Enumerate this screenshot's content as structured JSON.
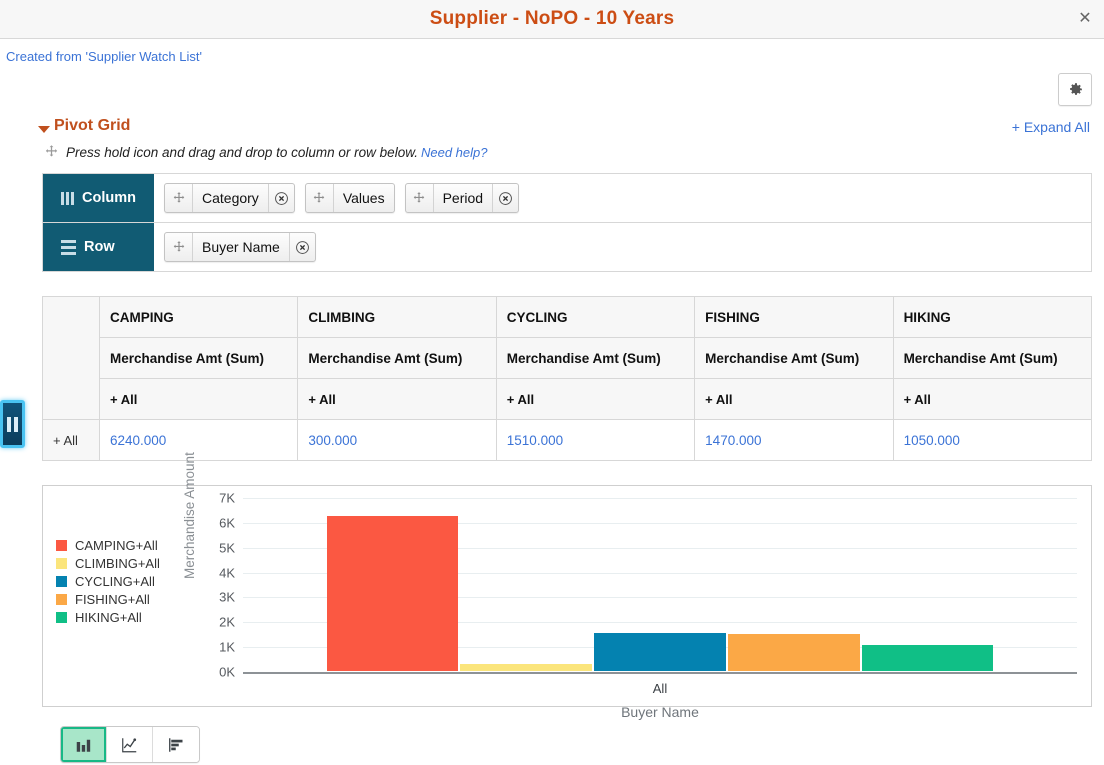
{
  "window": {
    "title": "Supplier - NoPO - 10 Years",
    "close_label": "✕",
    "close_icon": "close-icon",
    "title_color": "#cc4d14"
  },
  "subheader": {
    "created_from": "Created from 'Supplier Watch List'",
    "link_color": "#3b73d6"
  },
  "toolbar": {
    "gear_icon": "gear-icon"
  },
  "pivot": {
    "section_title": "Pivot Grid",
    "expand_all": "+ Expand All",
    "hint": "Press hold icon and drag and drop to column or row below.",
    "need_help": "Need help?",
    "move_icon": "move-icon",
    "zones": [
      {
        "label": "Column",
        "icon": "column-bars-icon",
        "chips": [
          {
            "label": "Category",
            "grip_icon": "move-icon",
            "close_icon": "remove-circle-icon",
            "removable": true
          },
          {
            "label": "Values",
            "grip_icon": "move-icon",
            "close_icon": "",
            "removable": false
          },
          {
            "label": "Period",
            "grip_icon": "move-icon",
            "close_icon": "remove-circle-icon",
            "removable": true
          }
        ]
      },
      {
        "label": "Row",
        "icon": "row-lines-icon",
        "chips": [
          {
            "label": "Buyer Name",
            "grip_icon": "move-icon",
            "close_icon": "remove-circle-icon",
            "removable": true
          }
        ]
      }
    ]
  },
  "table": {
    "corner_blank": "",
    "categories": [
      "CAMPING",
      "CLIMBING",
      "CYCLING",
      "FISHING",
      "HIKING"
    ],
    "measure_header": "Merchandise Amt (Sum)",
    "period_header": "+ All",
    "row_header": "+ All",
    "values": [
      "6240.000",
      "300.000",
      "1510.000",
      "1470.000",
      "1050.000"
    ],
    "value_color": "#3b73d6"
  },
  "chart_data": {
    "type": "bar",
    "title": "",
    "xlabel": "Buyer Name",
    "ylabel": "Merchandise Amount",
    "categories": [
      "All"
    ],
    "x_tick_labels": [
      "All"
    ],
    "ylim": [
      0,
      7000
    ],
    "ytick_labels": [
      "0K",
      "1K",
      "2K",
      "3K",
      "4K",
      "5K",
      "6K",
      "7K"
    ],
    "ytick_values": [
      0,
      1000,
      2000,
      3000,
      4000,
      5000,
      6000,
      7000
    ],
    "grid": true,
    "legend_position": "left",
    "series": [
      {
        "name": "CAMPING+All",
        "values": [
          6240
        ],
        "color": "#fb5842"
      },
      {
        "name": "CLIMBING+All",
        "values": [
          300
        ],
        "color": "#fbe57c"
      },
      {
        "name": "CYCLING+All",
        "values": [
          1510
        ],
        "color": "#0482b0"
      },
      {
        "name": "FISHING+All",
        "values": [
          1470
        ],
        "color": "#fba846"
      },
      {
        "name": "HIKING+All",
        "values": [
          1050
        ],
        "color": "#10bf86"
      }
    ]
  },
  "chart_types": [
    {
      "name": "bar-chart",
      "icon": "bar-chart-icon",
      "active": true
    },
    {
      "name": "line-chart",
      "icon": "line-chart-icon",
      "active": false
    },
    {
      "name": "horizontal-bar-chart",
      "icon": "horizontal-bar-chart-icon",
      "active": false
    }
  ],
  "left_handle": {
    "icon": "pause-handle-icon"
  }
}
